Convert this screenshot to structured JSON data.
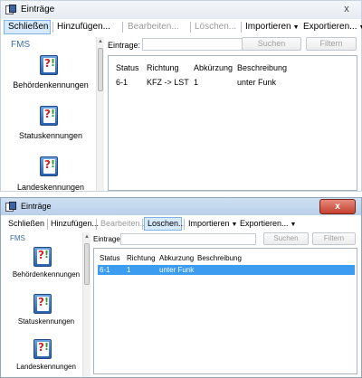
{
  "windows": [
    {
      "title": "Einträge",
      "close_label": "x",
      "toolbar": {
        "close": "Schließen",
        "add": "Hinzufügen...",
        "edit": "Bearbeiten...",
        "delete": "Löschen...",
        "import": "Importieren",
        "export": "Exportieren..."
      },
      "sidebar": {
        "group": "FMS",
        "items": [
          "Behördenkennungen",
          "Statuskennungen",
          "Landeskennungen"
        ]
      },
      "filter": {
        "label": "Eintrage:",
        "value": "",
        "search_button": "Suchen",
        "filter_button": "Filtern"
      },
      "table": {
        "columns": [
          "Status",
          "Richtung",
          "Abkürzung",
          "Beschreibung"
        ],
        "rows": [
          [
            "6-1",
            "KFZ -> LST",
            "1",
            "unter Funk"
          ]
        ]
      }
    },
    {
      "title": "Einträge",
      "close_label": "x",
      "toolbar": {
        "close": "Schließen",
        "add": "Hinzufügen...",
        "edit": "Bearbeiten...",
        "delete": "Loschen...",
        "import": "Importieren",
        "export": "Exportieren..."
      },
      "sidebar": {
        "group": "FMS",
        "items": [
          "Behördenkennungen",
          "Statuskennungen",
          "Landeskennungen"
        ]
      },
      "filter": {
        "label": "Eintrage:",
        "value": "",
        "search_button": "Suchen",
        "filter_button": "Filtern"
      },
      "table": {
        "columns": [
          "Status",
          "Richtung",
          "Abkurzung",
          "Beschreibung"
        ],
        "rows": [
          [
            "6-1",
            "1",
            "unter Funk",
            ""
          ]
        ]
      }
    }
  ],
  "colors": {
    "selection": "#3b9cf0",
    "accent": "#3a6da8",
    "close_button": "#c6402e"
  },
  "icons": [
    "app-icon",
    "book-question-icon",
    "close-icon",
    "dropdown-arrow-icon"
  ]
}
